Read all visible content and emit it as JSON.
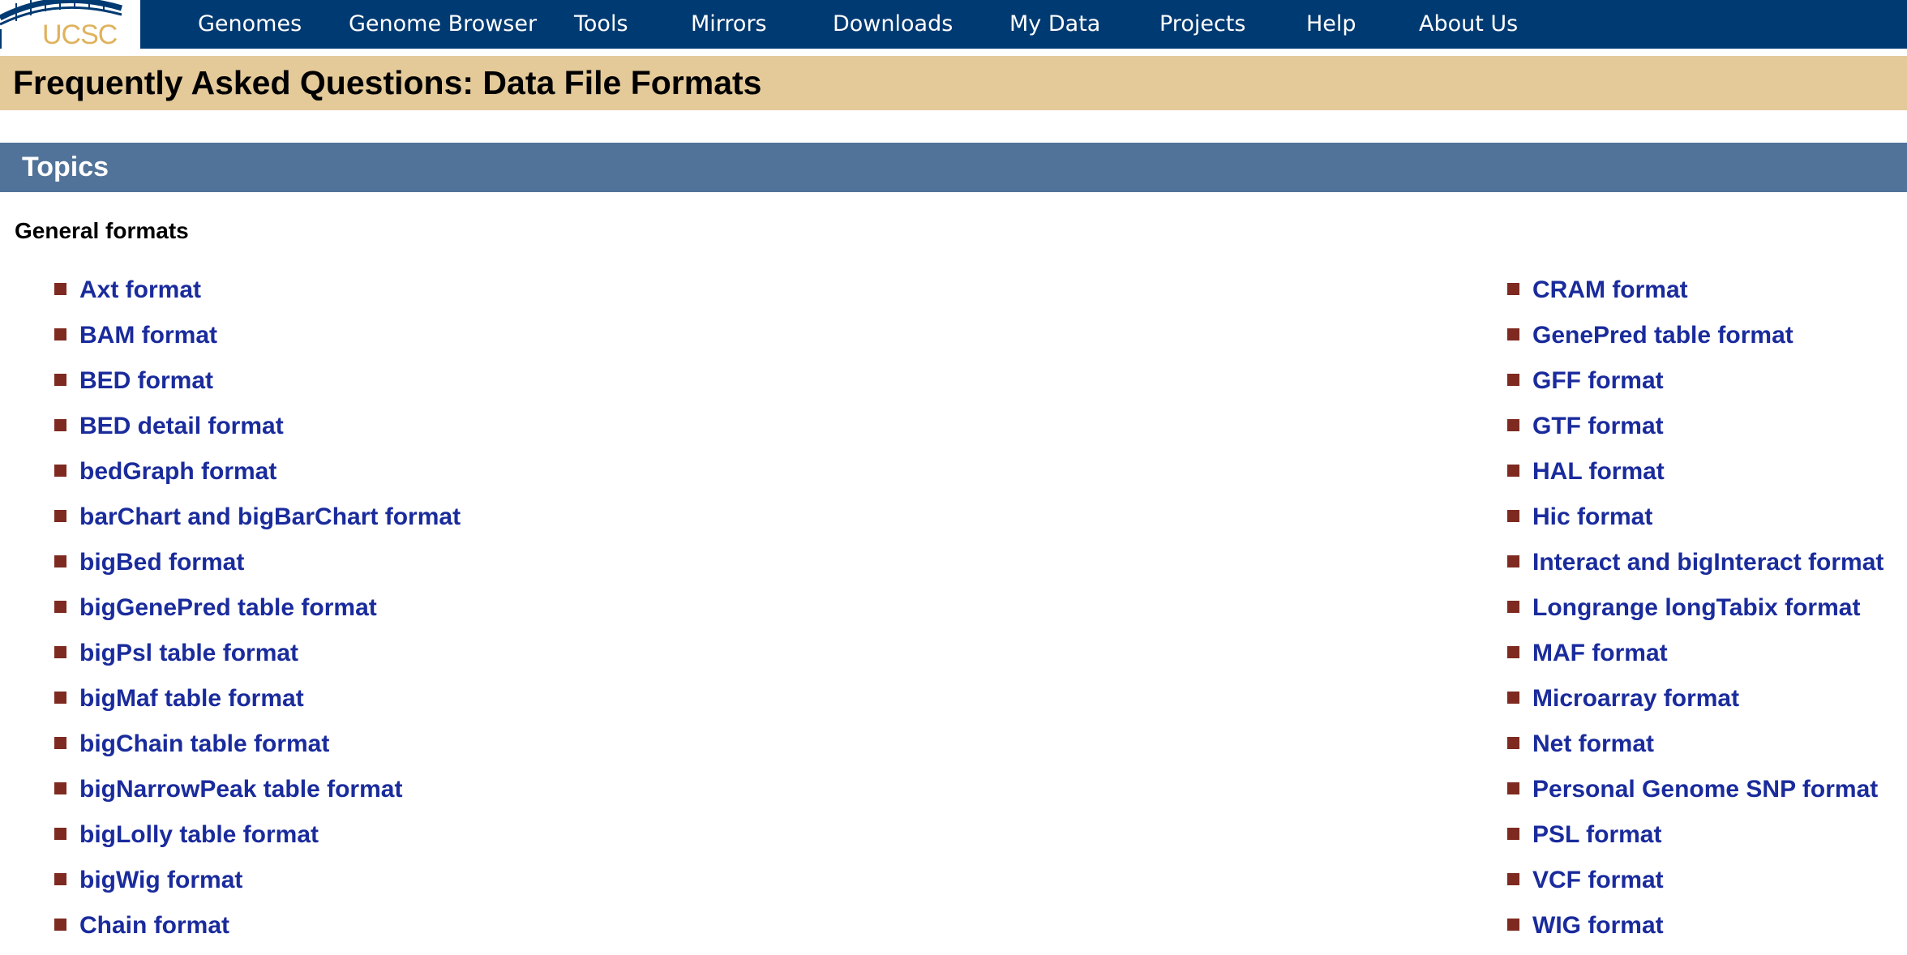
{
  "logo": {
    "text": "UCSC"
  },
  "nav": {
    "items": [
      {
        "label": "Genomes"
      },
      {
        "label": "Genome Browser"
      },
      {
        "label": "Tools"
      },
      {
        "label": "Mirrors"
      },
      {
        "label": "Downloads"
      },
      {
        "label": "My Data"
      },
      {
        "label": "Projects"
      },
      {
        "label": "Help"
      },
      {
        "label": "About Us"
      }
    ]
  },
  "page": {
    "title": "Frequently Asked Questions: Data File Formats",
    "topics_heading": "Topics",
    "section_heading": "General formats"
  },
  "formats": {
    "left": [
      "Axt format",
      "BAM format",
      "BED format",
      "BED detail format",
      "bedGraph format",
      "barChart and bigBarChart format",
      "bigBed format",
      "bigGenePred table format",
      "bigPsl table format",
      "bigMaf table format",
      "bigChain table format",
      "bigNarrowPeak table format",
      "bigLolly table format",
      "bigWig format",
      "Chain format"
    ],
    "right": [
      "CRAM format",
      "GenePred table format",
      "GFF format",
      "GTF format",
      "HAL format",
      "Hic format",
      "Interact and bigInteract format",
      "Longrange longTabix format",
      "MAF format",
      "Microarray format",
      "Net format",
      "Personal Genome SNP format",
      "PSL format",
      "VCF format",
      "WIG format"
    ]
  },
  "colors": {
    "navbar": "#003a72",
    "title_bar": "#e4c999",
    "topics_bar": "#517399",
    "link": "#1a2b9c",
    "bullet": "#7e2a21",
    "logo_gold": "#e0b25c"
  }
}
